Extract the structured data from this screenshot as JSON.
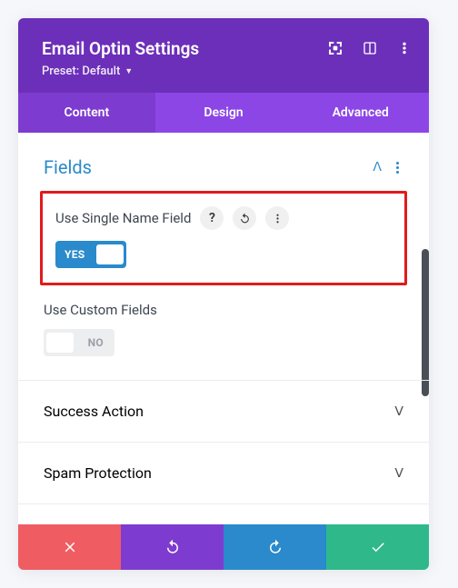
{
  "header": {
    "title": "Email Optin Settings",
    "preset_label": "Preset: Default"
  },
  "tabs": {
    "content": "Content",
    "design": "Design",
    "advanced": "Advanced"
  },
  "sections": {
    "fields": {
      "title": "Fields",
      "use_single_name_field": {
        "label": "Use Single Name Field",
        "value": "YES"
      },
      "use_custom_fields": {
        "label": "Use Custom Fields",
        "value": "NO"
      }
    },
    "success_action": {
      "title": "Success Action"
    },
    "spam_protection": {
      "title": "Spam Protection"
    }
  }
}
